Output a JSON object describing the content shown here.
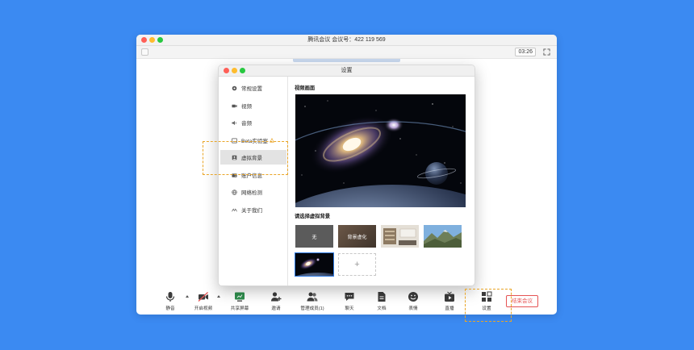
{
  "window": {
    "title": "腾讯会议 会议号：422 119 569",
    "timer": "03:26"
  },
  "toolbar": {
    "mute": "静音",
    "video": "开启视频",
    "share": "共享屏幕",
    "invite": "邀请",
    "members": "管理成员(1)",
    "chat": "聊天",
    "docs": "文档",
    "emoji": "表情",
    "live": "直播",
    "settings": "设置",
    "end_meeting": "结束会议"
  },
  "settings_dialog": {
    "title": "设置",
    "sidebar": [
      {
        "label": "常规设置",
        "icon": "gear-icon"
      },
      {
        "label": "视频",
        "icon": "camera-icon"
      },
      {
        "label": "音频",
        "icon": "speaker-icon"
      },
      {
        "label": "Beta实验室",
        "icon": "flask-icon"
      },
      {
        "label": "虚拟背景",
        "icon": "portrait-icon",
        "active": true
      },
      {
        "label": "账户信息",
        "icon": "id-card-icon"
      },
      {
        "label": "网络检测",
        "icon": "globe-icon"
      },
      {
        "label": "关于我们",
        "icon": "info-icon"
      }
    ],
    "preview_title": "视频画面",
    "choose_title": "请选择虚拟背景",
    "backgrounds": [
      {
        "label": "无"
      },
      {
        "label": "背景虚化"
      },
      {
        "label": ""
      },
      {
        "label": ""
      },
      {
        "label": "",
        "selected": true
      }
    ],
    "add_symbol": "+"
  },
  "colors": {
    "background": "#3b8af2",
    "highlight": "#e9a527",
    "end_button": "#e55353",
    "selected": "#2f7be5"
  }
}
